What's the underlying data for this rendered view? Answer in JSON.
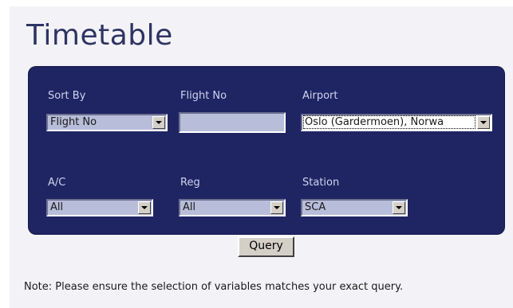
{
  "page": {
    "title": "Timetable",
    "note": "Note: Please ensure the selection of variables matches your exact query."
  },
  "form": {
    "sort_by": {
      "label": "Sort By",
      "value": "Flight No"
    },
    "flight_no": {
      "label": "Flight No",
      "value": ""
    },
    "airport": {
      "label": "Airport",
      "value": "Oslo (Gardermoen), Norwa"
    },
    "ac": {
      "label": "A/C",
      "value": "All"
    },
    "reg": {
      "label": "Reg",
      "value": "All"
    },
    "station": {
      "label": "Station",
      "value": "SCA"
    },
    "query_button": "Query"
  },
  "icons": {
    "dropdown_arrow": "chevron-down-icon"
  },
  "colors": {
    "title": "#2e3462",
    "panel_bg": "#1f2563",
    "label": "#cfd3ee",
    "input_bg": "#b8bdd9"
  }
}
